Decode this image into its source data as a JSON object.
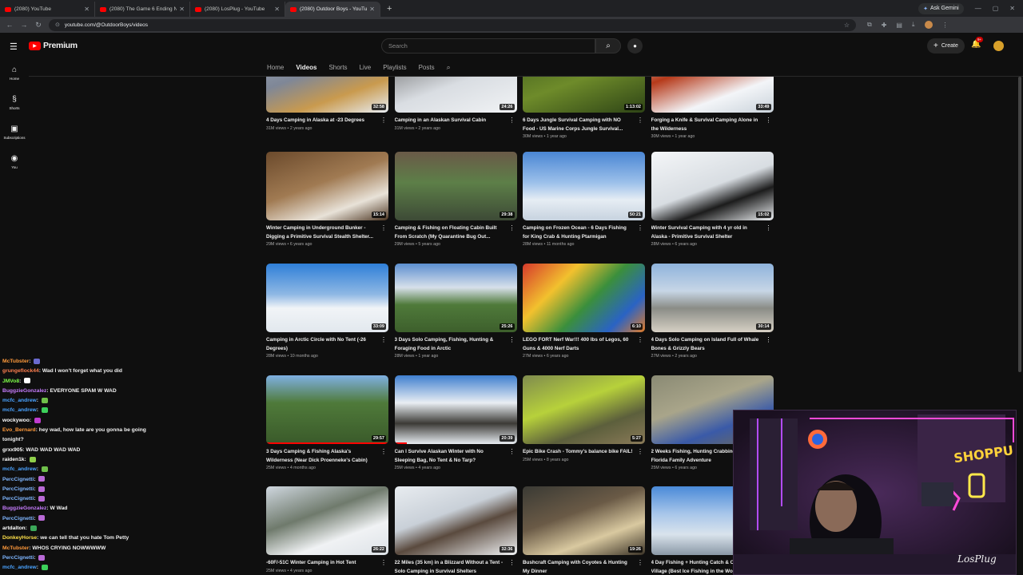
{
  "browser": {
    "tabs": [
      {
        "title": "(2080) YouTube"
      },
      {
        "title": "(2080) The Game 6 Ending No..."
      },
      {
        "title": "(2080) LosPlug - YouTube"
      },
      {
        "title": "(2080) Outdoor Boys - YouTube"
      }
    ],
    "active_tab": 3,
    "gemini_label": "Ask Gemini",
    "url": "youtube.com/@OutdoorBoys/videos"
  },
  "youtube": {
    "logo_text": "Premium",
    "search_placeholder": "Search",
    "create_label": "Create",
    "notif_count": "9+",
    "sidenav": [
      {
        "icon": "home-icon",
        "label": "Home"
      },
      {
        "icon": "shorts-icon",
        "label": "Shorts"
      },
      {
        "icon": "subscriptions-icon",
        "label": "Subscriptions"
      },
      {
        "icon": "you-icon",
        "label": "You"
      }
    ],
    "channel_tabs": [
      "Home",
      "Videos",
      "Shorts",
      "Live",
      "Playlists",
      "Posts"
    ],
    "active_channel_tab": "Videos"
  },
  "videos": [
    {
      "title": "4 Days Camping in Alaska at -23 Degrees",
      "meta": "31M views • 2 years ago",
      "duration": "32:58",
      "bg": "linear-gradient(160deg,#9aa6b8 0%,#7f8797 40%,#c99a4e 70%,#e8eef4 100%)"
    },
    {
      "title": "Camping in an Alaskan Survival Cabin",
      "meta": "31M views • 2 years ago",
      "duration": "24:26",
      "bg": "linear-gradient(160deg,#5a5a5a 0%,#d9dde2 55%,#f1f3f5 100%)"
    },
    {
      "title": "6 Days Jungle Survival Camping with NO Food - US Marine Corps Jungle Survival...",
      "meta": "30M views • 1 year ago",
      "duration": "1:13:02",
      "bg": "linear-gradient(160deg,#3d5a1e 0%,#6e8b2a 50%,#2e4416 100%)"
    },
    {
      "title": "Forging a Knife & Survival Camping Alone in the Wilderness",
      "meta": "30M views • 1 year ago",
      "duration": "33:49",
      "bg": "linear-gradient(160deg,#e6e9ee 0%,#b63a1a 35%,#f3f5f8 70%,#c9d2da 100%)"
    },
    {
      "title": "Winter Camping in Underground Bunker - Digging a Primitive Survival Stealth Shelter...",
      "meta": "29M views • 6 years ago",
      "duration": "15:14",
      "bg": "linear-gradient(160deg,#6b4a2c 0%,#a07a52 45%,#e8e2d8 75%,#4b3420 100%)"
    },
    {
      "title": "Camping & Fishing on Floating Cabin Built From Scratch (My Quarantine Bug Out...",
      "meta": "29M views • 5 years ago",
      "duration": "29:38",
      "bg": "linear-gradient(180deg,#6a5a48 0%,#5d7f48 45%,#3d4a36 100%)"
    },
    {
      "title": "Camping on Frozen Ocean - 6 Days Fishing for King Crab & Hunting Ptarmigan",
      "meta": "28M views • 11 months ago",
      "duration": "50:21",
      "bg": "linear-gradient(180deg,#4a86d4 0%,#9cc0ea 45%,#e6edf4 70%,#c7d3df 100%)"
    },
    {
      "title": "Winter Survival Camping with 4 yr old in Alaska - Primitive Survival Shelter",
      "meta": "28M views • 6 years ago",
      "duration": "15:02",
      "bg": "linear-gradient(160deg,#f4f6f8 0%,#d8dde2 50%,#1c1c1c 70%,#eef1f4 100%)"
    },
    {
      "title": "Camping in Arctic Circle with No Tent (-26 Degrees)",
      "meta": "28M views • 10 months ago",
      "duration": "33:09",
      "bg": "linear-gradient(180deg,#2f7fd8 0%,#8fb8e4 45%,#f1f4f7 65%,#e2e8ee 100%)"
    },
    {
      "title": "3 Days Solo Camping, Fishing, Hunting & Foraging Food in Arctic",
      "meta": "28M views • 1 year ago",
      "duration": "25:26",
      "bg": "linear-gradient(180deg,#5c8fd0 0%,#d7e0ea 35%,#4f7a3a 60%,#3d5f2c 100%)"
    },
    {
      "title": "LEGO FORT Nerf War!!! 400 lbs of Legos, 60 Guns & 4000 Nerf Darts",
      "meta": "27M views • 6 years ago",
      "duration": "6:10",
      "bg": "linear-gradient(135deg,#d63a2c 0%,#f2c12e 30%,#3b8f3c 55%,#2a63c4 80%,#e07b28 100%)"
    },
    {
      "title": "4 Days Solo Camping on Island Full of Whale Bones & Grizzly Bears",
      "meta": "27M views • 2 years ago",
      "duration": "30:14",
      "bg": "linear-gradient(180deg,#8fb3dc 0%,#c7d6e6 40%,#8a8c86 65%,#d6d0c4 100%)"
    },
    {
      "title": "3 Days Camping & Fishing Alaska's Wilderness (Near Dick Proenneke's Cabin)",
      "meta": "25M views • 4 months ago",
      "duration": "29:57",
      "bg": "linear-gradient(180deg,#7fb0e2 0%,#4f7a3a 40%,#3a5a2a 100%)"
    },
    {
      "title": "Can I Survive Alaskan Winter with No Sleeping Bag, No Tent & No Tarp?",
      "meta": "25M views • 4 years ago",
      "duration": "20:39",
      "bg": "linear-gradient(180deg,#3f7fcf 0%,#e9eef3 40%,#3c3a36 70%,#e7ecf1 100%)"
    },
    {
      "title": "Epic Bike Crash - Tommy's balance bike FAIL!",
      "meta": "25M views • 8 years ago",
      "duration": "5:27",
      "bg": "linear-gradient(160deg,#7f8b4e 0%,#b7d13b 40%,#5c5f3c 70%,#8a7a58 100%)"
    },
    {
      "title": "2 Weeks Fishing, Hunting Crabbing... Florida. Florida Family Adventure",
      "meta": "25M views • 6 years ago",
      "duration": "",
      "bg": "linear-gradient(160deg,#8a8a74 0%,#a9a58a 40%,#3a5aa8 70%,#6f6a54 100%)"
    },
    {
      "title": "-60F/-51C Winter Camping in Hot Tent",
      "meta": "25M views • 4 years ago",
      "duration": "26:22",
      "bg": "linear-gradient(160deg,#cfd7df 0%,#6f7a6c 40%,#f0f2f4 70%,#dde2e7 100%)"
    },
    {
      "title": "22 Miles (35 km) in a Blizzard Without a Tent - Solo Camping in Survival Shelters",
      "meta": "25M views • 3 years ago",
      "duration": "32:36",
      "bg": "linear-gradient(160deg,#e8ecf0 0%,#c9d0d8 40%,#5a4a3e 60%,#f1f3f5 100%)"
    },
    {
      "title": "Bushcraft Camping with Coyotes & Hunting My Dinner",
      "meta": "25M views • 5 years ago",
      "duration": "19:26",
      "bg": "linear-gradient(160deg,#3a3a34 0%,#6a5a46 40%,#d9c9a0 70%,#3a3226 100%)"
    },
    {
      "title": "4 Day Fishing + Hunting Catch & C... Inuit Village (Best Ice Fishing in the World)",
      "meta": "25M views • 3 years ago",
      "duration": "",
      "bg": "linear-gradient(180deg,#4a8ad8 0%,#a8c6ea 40%,#d9e3ec 70%,#8a98a6 100%)"
    }
  ],
  "chat": [
    {
      "user": "McTubster",
      "color": "#ff9a3c",
      "text": "",
      "emote": "#6a6acf"
    },
    {
      "user": "grungeflock44",
      "color": "#ff7f50",
      "text": "Wad I won't forget what you did",
      "emote": ""
    },
    {
      "user": "JMVo8",
      "color": "#7fff4a",
      "text": "",
      "emote": "#ffffff"
    },
    {
      "user": "BuggzieGonzalez",
      "color": "#c77dff",
      "text": "EVERYONE SPAM W WAD",
      "emote": ""
    },
    {
      "user": "mcfc_andrew",
      "color": "#4aa3ff",
      "text": "",
      "emote": "#6fbf4a"
    },
    {
      "user": "mcfc_andrew",
      "color": "#4aa3ff",
      "text": "",
      "emote": "#3ccf5a"
    },
    {
      "user": "wockywoo",
      "color": "#ffffff",
      "text": "",
      "emote": "#c03ccf"
    },
    {
      "user": "Evo_Bernard",
      "color": "#ff9a3c",
      "text": "hey wad, how late are you gonna be going",
      "emote": ""
    },
    {
      "user": "",
      "color": "#f1f1f1",
      "text": "tonight?",
      "emote": ""
    },
    {
      "user": "grxx905",
      "color": "#ffffff",
      "text": "WAD WAD WAD WAD",
      "emote": ""
    },
    {
      "user": "raiden1k",
      "color": "#ffffff",
      "text": "",
      "emote": "#8fcf4a"
    },
    {
      "user": "mcfc_andrew",
      "color": "#4aa3ff",
      "text": "",
      "emote": "#6fbf4a"
    },
    {
      "user": "PercCignetti",
      "color": "#7fb6ff",
      "text": "",
      "emote": "#b96ad6"
    },
    {
      "user": "PercCignetti",
      "color": "#7fb6ff",
      "text": "",
      "emote": "#b96ad6"
    },
    {
      "user": "PercCignetti",
      "color": "#7fb6ff",
      "text": "",
      "emote": "#b96ad6"
    },
    {
      "user": "BuggzieGonzalez",
      "color": "#c77dff",
      "text": "W Wad",
      "emote": ""
    },
    {
      "user": "PercCignetti",
      "color": "#7fb6ff",
      "text": "",
      "emote": "#b96ad6"
    },
    {
      "user": "artdalton",
      "color": "#ffffff",
      "text": "",
      "emote": "#3ca85a"
    },
    {
      "user": "DonkeyHorse",
      "color": "#ffe14a",
      "text": "we can tell that you hate Tom Petty",
      "emote": ""
    },
    {
      "user": "McTubster",
      "color": "#ff9a3c",
      "text": "WHOS CRYING NOWWWWW",
      "emote": ""
    },
    {
      "user": "PercCignetti",
      "color": "#7fb6ff",
      "text": "",
      "emote": "#b96ad6"
    },
    {
      "user": "mcfc_andrew",
      "color": "#4aa3ff",
      "text": "",
      "emote": "#3ccf5a"
    }
  ],
  "webcam": {
    "neon_sign": "SHOPPU",
    "watermark": "LosPlug"
  }
}
